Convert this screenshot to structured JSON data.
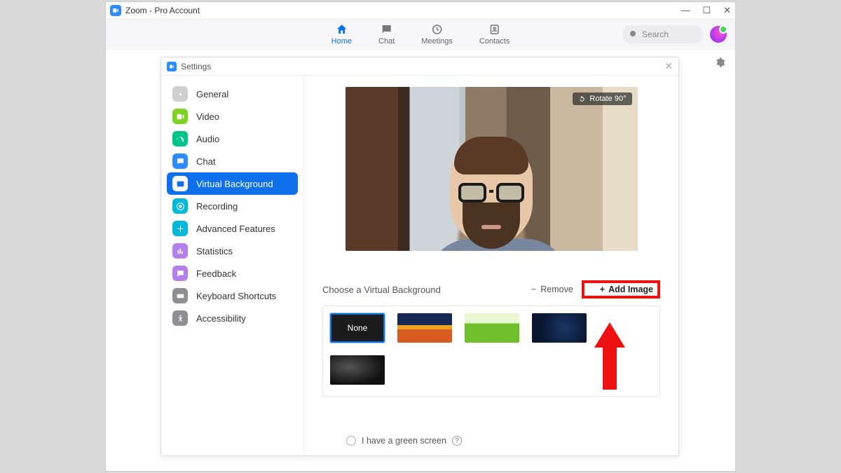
{
  "window": {
    "title": "Zoom - Pro Account"
  },
  "nav": {
    "home": "Home",
    "chat": "Chat",
    "meetings": "Meetings",
    "contacts": "Contacts",
    "search_placeholder": "Search"
  },
  "settings": {
    "title": "Settings",
    "sidebar": {
      "general": "General",
      "video": "Video",
      "audio": "Audio",
      "chat": "Chat",
      "virtual_background": "Virtual Background",
      "recording": "Recording",
      "advanced_features": "Advanced Features",
      "statistics": "Statistics",
      "feedback": "Feedback",
      "keyboard_shortcuts": "Keyboard Shortcuts",
      "accessibility": "Accessibility"
    },
    "main": {
      "rotate_label": "Rotate 90°",
      "choose_label": "Choose a Virtual Background",
      "remove_label": "Remove",
      "add_image_label": "Add Image",
      "thumbs": {
        "none": "None"
      },
      "green_screen_label": "I have a green screen"
    }
  }
}
